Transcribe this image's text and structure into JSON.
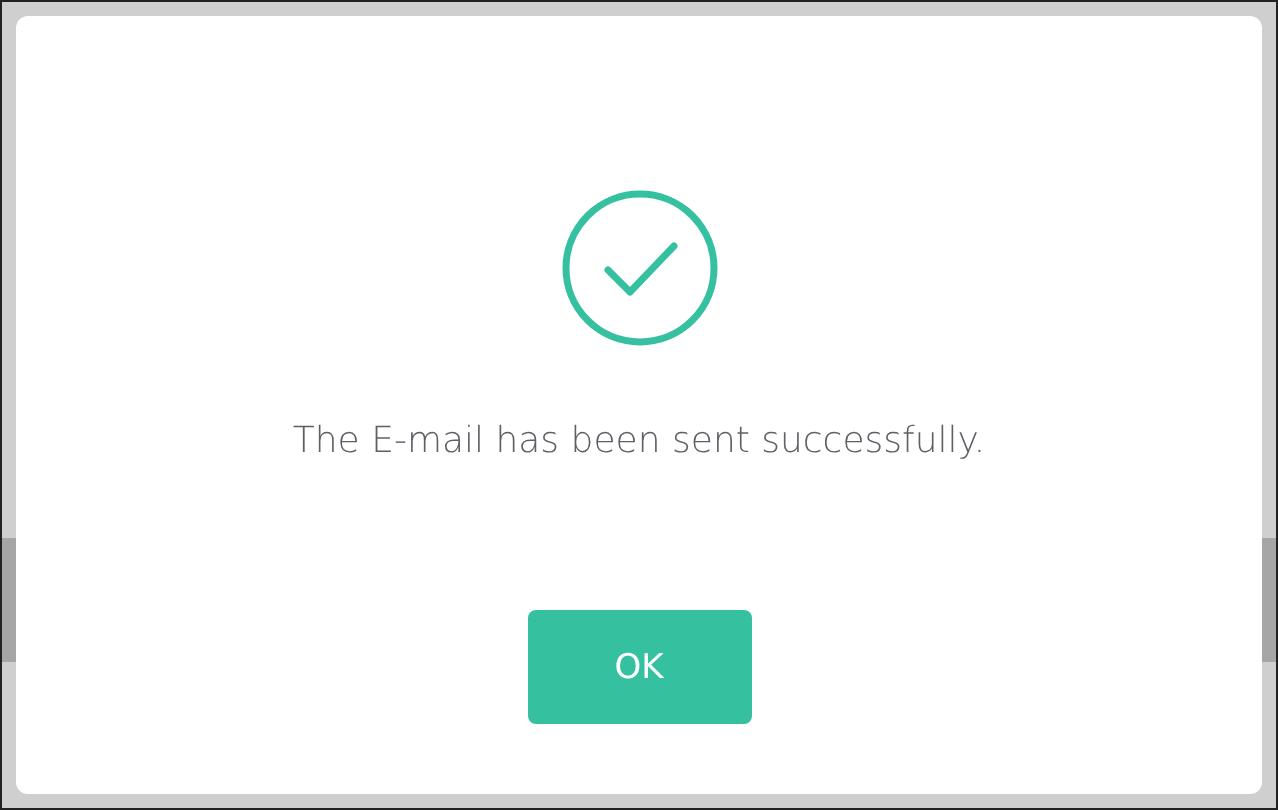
{
  "dialog": {
    "message": "The E-mail has been sent successfully.",
    "button": "OK"
  }
}
